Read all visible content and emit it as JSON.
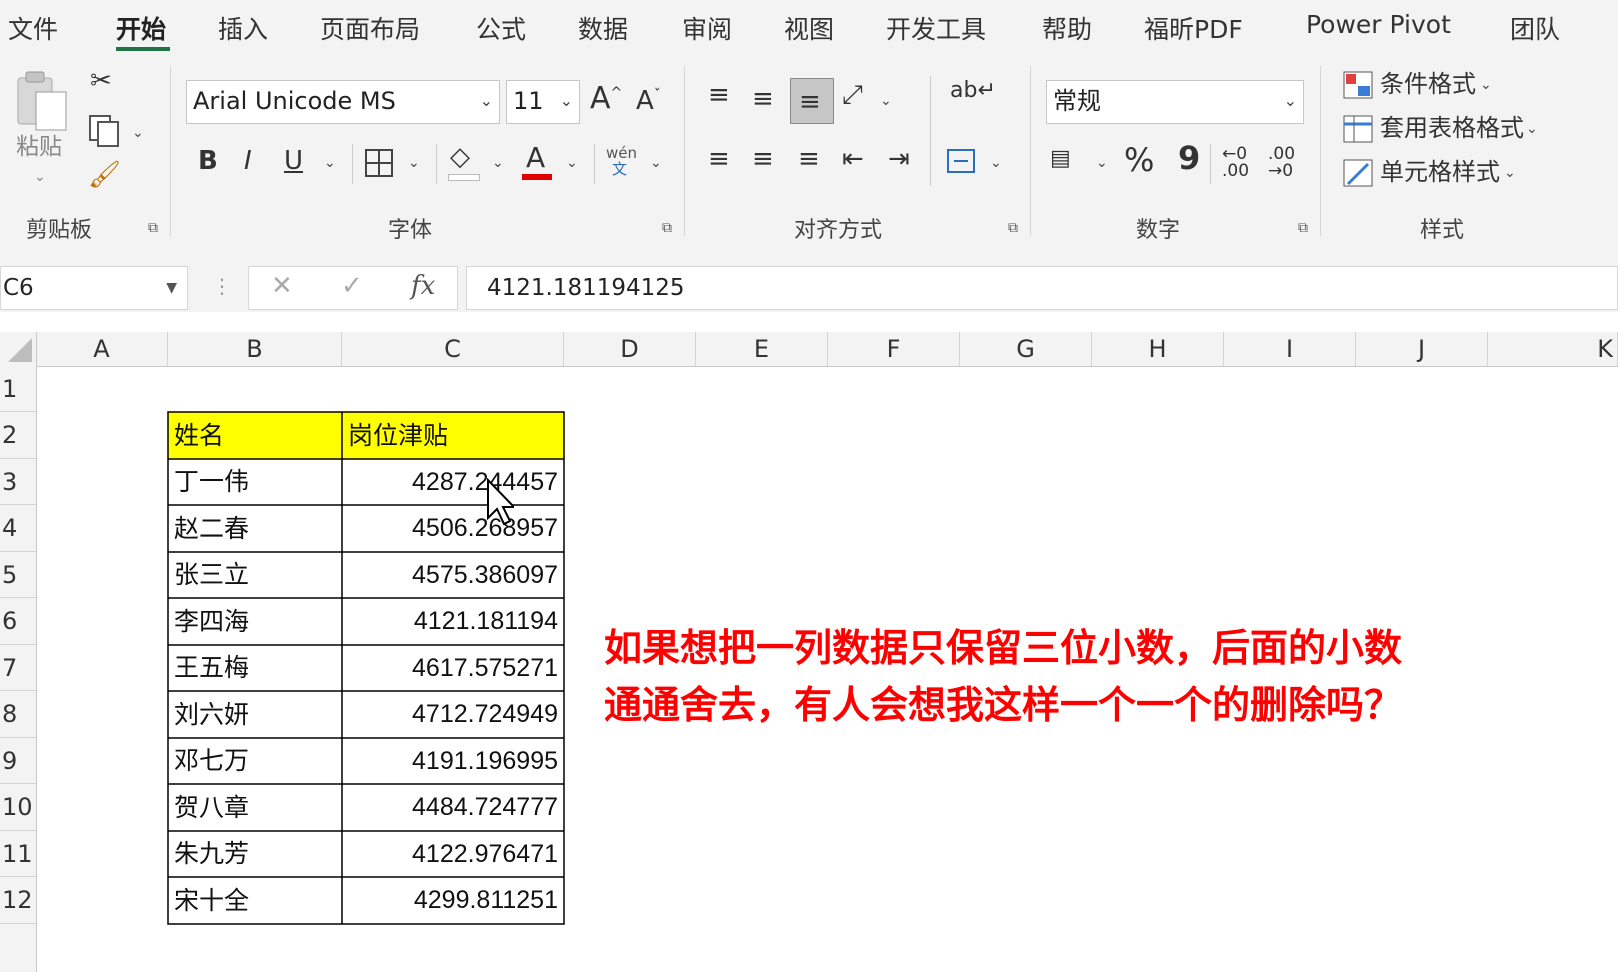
{
  "tabs": [
    "文件",
    "开始",
    "插入",
    "页面布局",
    "公式",
    "数据",
    "审阅",
    "视图",
    "开发工具",
    "帮助",
    "福昕PDF",
    "Power Pivot",
    "团队"
  ],
  "ribbon": {
    "clipboard": {
      "paste_label": "粘贴",
      "group_label": "剪贴板"
    },
    "font": {
      "font_name": "Arial Unicode MS",
      "font_size": "11",
      "group_label": "字体",
      "phonetic_top": "wén",
      "phonetic_bottom": "文"
    },
    "alignment": {
      "group_label": "对齐方式"
    },
    "number": {
      "format": "常规",
      "group_label": "数字",
      "percent": "%",
      "comma": "9"
    },
    "styles": {
      "conditional": "条件格式",
      "table_format": "套用表格格式",
      "cell_styles": "单元格样式",
      "group_label": "样式"
    }
  },
  "formula_bar": {
    "name_box": "C6",
    "fx": "fx",
    "formula": "4121.181194125"
  },
  "columns": [
    "A",
    "B",
    "C",
    "D",
    "E",
    "F",
    "G",
    "H",
    "I",
    "J",
    "K"
  ],
  "rows": [
    "1",
    "2",
    "3",
    "4",
    "5",
    "6",
    "7",
    "8",
    "9",
    "10",
    "11",
    "12"
  ],
  "table": {
    "headers": [
      "姓名",
      "岗位津贴"
    ],
    "rows": [
      [
        "丁一伟",
        "4287.244457"
      ],
      [
        "赵二春",
        "4506.268957"
      ],
      [
        "张三立",
        "4575.386097"
      ],
      [
        "李四海",
        "4121.181194"
      ],
      [
        "王五梅",
        "4617.575271"
      ],
      [
        "刘六妍",
        "4712.724949"
      ],
      [
        "邓七万",
        "4191.196995"
      ],
      [
        "贺八章",
        "4484.724777"
      ],
      [
        "朱九芳",
        "4122.976471"
      ],
      [
        "宋十全",
        "4299.811251"
      ]
    ]
  },
  "annotation": {
    "line1": "如果想把一列数据只保留三位小数，后面的小数",
    "line2": "通通舍去，有人会想我这样一个一个的删除吗？"
  },
  "colors": {
    "accent": "#217346",
    "header_fill": "#ffff00",
    "annotation": "#ff0000",
    "font_red": "#e00000"
  }
}
